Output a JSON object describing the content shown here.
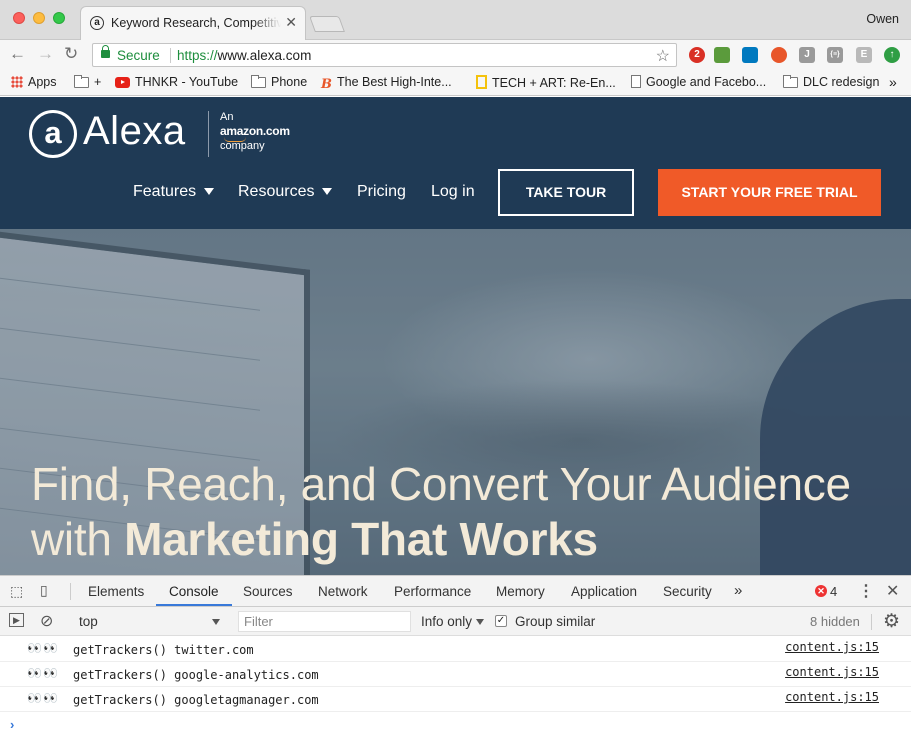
{
  "browser": {
    "tab_title": "Keyword Research, Competitive",
    "tab_close": "✕",
    "profile_name": "Owen",
    "secure_label": "Secure",
    "url_protocol": "https://",
    "url_host": "www.alexa.com",
    "bookmarks": [
      {
        "label": "Apps",
        "icon": "apps-grid-icon"
      },
      {
        "label": "+",
        "icon": "folder-icon"
      },
      {
        "label": "THNKR - YouTube",
        "icon": "youtube-icon"
      },
      {
        "label": "Phone",
        "icon": "folder-icon"
      },
      {
        "label": "The Best High-Inte...",
        "icon": "blogger-icon"
      },
      {
        "label": "TECH + ART: Re-En...",
        "icon": "bookmark-icon"
      },
      {
        "label": "Google and Facebo...",
        "icon": "page-icon"
      },
      {
        "label": "DLC redesign",
        "icon": "folder-icon"
      }
    ],
    "bookmarks_overflow": "»",
    "extensions": [
      {
        "name": "ext-red",
        "badge": "2",
        "color": "#d93025"
      },
      {
        "name": "ext-green",
        "badge": "",
        "color": "#5b9b3c"
      },
      {
        "name": "ext-trello",
        "badge": "",
        "color": "#0079bf"
      },
      {
        "name": "ext-orange",
        "badge": "",
        "color": "#e8562a"
      },
      {
        "name": "ext-j",
        "badge": "J",
        "color": "#9a9a9a"
      },
      {
        "name": "ext-json",
        "badge": "{≡}",
        "color": "#9a9a9a"
      },
      {
        "name": "ext-e",
        "badge": "E",
        "color": "#b9b9b9"
      },
      {
        "name": "ext-upload",
        "badge": "↑",
        "color": "#2f9e44"
      }
    ]
  },
  "site": {
    "logo_symbol": "a",
    "logo_word": "Alexa",
    "logo_an": "An",
    "logo_amazon": "amazon.com",
    "logo_company": "company",
    "nav": {
      "features": "Features",
      "resources": "Resources",
      "pricing": "Pricing",
      "login": "Log in"
    },
    "take_tour": "TAKE TOUR",
    "free_trial": "START YOUR FREE TRIAL",
    "headline_line1": "Find, Reach, and Convert Your Audience",
    "headline_line2_plain": "with ",
    "headline_line2_bold": "Marketing That Works",
    "accent_color": "#f05a28",
    "header_color": "#1f3a55"
  },
  "devtools": {
    "tabs": [
      "Elements",
      "Console",
      "Sources",
      "Network",
      "Performance",
      "Memory",
      "Application",
      "Security"
    ],
    "active_tab": "Console",
    "more_tabs": "»",
    "error_count": "4",
    "context": "top",
    "filter_placeholder": "Filter",
    "level": "Info only",
    "group_similar": "Group similar",
    "group_checked": "✓",
    "hidden": "8 hidden",
    "logs": [
      {
        "eyes": "👀 👀",
        "message": "getTrackers() twitter.com",
        "source": "content.js:15"
      },
      {
        "eyes": "👀 👀",
        "message": "getTrackers() google-analytics.com",
        "source": "content.js:15"
      },
      {
        "eyes": "👀 👀",
        "message": "getTrackers() googletagmanager.com",
        "source": "content.js:15"
      }
    ],
    "prompt": "›"
  }
}
